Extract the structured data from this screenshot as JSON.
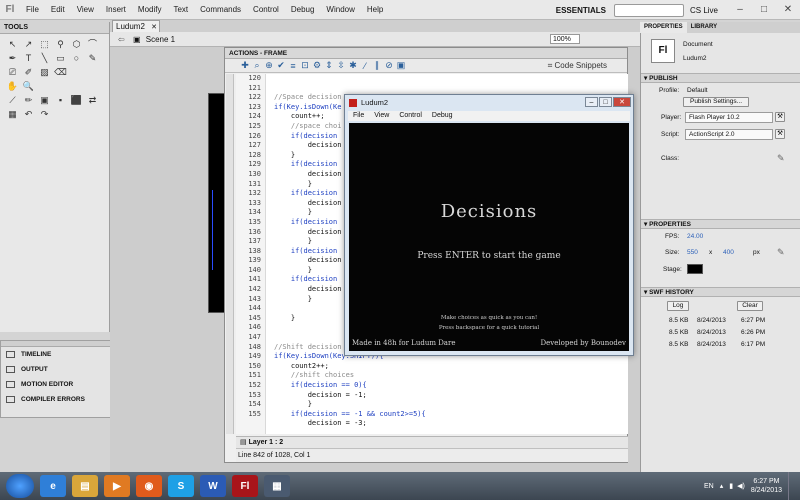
{
  "menubar": {
    "logo": "Fl",
    "items": [
      "File",
      "Edit",
      "View",
      "Insert",
      "Modify",
      "Text",
      "Commands",
      "Control",
      "Debug",
      "Window",
      "Help"
    ],
    "workspace": "ESSENTIALS",
    "cs_live": "CS Live",
    "win_min": "–",
    "win_max": "□",
    "win_close": "✕"
  },
  "document_tab": {
    "label": "Ludum2",
    "close": "✕"
  },
  "scene_label": "Scene 1",
  "zoom": "100%",
  "tools_panel": {
    "title": "TOOLS",
    "tools": [
      "↖",
      "↗",
      "⬚",
      "⚲",
      "⬡",
      "⌒",
      "✒",
      "T",
      "╲",
      "▭",
      "○",
      "✎",
      "⎚",
      "✐",
      "▨",
      "⌫",
      "",
      "",
      "✋",
      "🔍",
      "",
      "",
      "",
      "",
      "⟋",
      "✏",
      "▣",
      "▪",
      "⬛",
      "⇄",
      "▦",
      "↶",
      "↷",
      "",
      "",
      ""
    ]
  },
  "dock_panel": {
    "items": [
      "TIMELINE",
      "OUTPUT",
      "MOTION EDITOR",
      "COMPILER ERRORS"
    ]
  },
  "actions": {
    "title": "ACTIONS - FRAME",
    "code_snippets": "Code Snippets",
    "layer": "Layer 1 : 2",
    "status": "Line 842 of 1028, Col 1",
    "line_numbers": [
      "120",
      "121",
      "122",
      "123",
      "124",
      "125",
      "126",
      "127",
      "128",
      "129",
      "130",
      "131",
      "132",
      "133",
      "134",
      "135",
      "136",
      "137",
      "138",
      "139",
      "140",
      "141",
      "142",
      "143",
      "144",
      "145",
      "146",
      "147",
      "148",
      "149",
      "150",
      "151",
      "152",
      "153",
      "154",
      "155"
    ],
    "code_lines": [
      {
        "t": "",
        "c": "plain"
      },
      {
        "t": "",
        "c": "plain"
      },
      {
        "t": "//Space decision",
        "c": "cmt"
      },
      {
        "t": "if(Key.isDown(Ke",
        "c": "kw"
      },
      {
        "t": "    count++;",
        "c": "plain"
      },
      {
        "t": "    //space choi",
        "c": "cmt"
      },
      {
        "t": "    if(decision",
        "c": "kw"
      },
      {
        "t": "        decision",
        "c": "plain"
      },
      {
        "t": "    }",
        "c": "plain"
      },
      {
        "t": "    if(decision",
        "c": "kw"
      },
      {
        "t": "        decision",
        "c": "plain"
      },
      {
        "t": "        }",
        "c": "plain"
      },
      {
        "t": "    if(decision",
        "c": "kw"
      },
      {
        "t": "        decision",
        "c": "plain"
      },
      {
        "t": "        }",
        "c": "plain"
      },
      {
        "t": "    if(decision",
        "c": "kw"
      },
      {
        "t": "        decision",
        "c": "plain"
      },
      {
        "t": "        }",
        "c": "plain"
      },
      {
        "t": "    if(decision",
        "c": "kw"
      },
      {
        "t": "        decision",
        "c": "plain"
      },
      {
        "t": "        }",
        "c": "plain"
      },
      {
        "t": "    if(decision",
        "c": "kw"
      },
      {
        "t": "        decision",
        "c": "plain"
      },
      {
        "t": "        }",
        "c": "plain"
      },
      {
        "t": "",
        "c": "plain"
      },
      {
        "t": "    }",
        "c": "plain"
      },
      {
        "t": "",
        "c": "plain"
      },
      {
        "t": "",
        "c": "plain"
      },
      {
        "t": "//Shift decision",
        "c": "cmt"
      },
      {
        "t": "if(Key.isDown(Key.SHIFT)){",
        "c": "kw"
      },
      {
        "t": "    count2++;",
        "c": "plain"
      },
      {
        "t": "    //shift choices",
        "c": "cmt"
      },
      {
        "t": "    if(decision == 0){",
        "c": "kw"
      },
      {
        "t": "        decision = -1;",
        "c": "plain"
      },
      {
        "t": "        }",
        "c": "plain"
      },
      {
        "t": "    if(decision == -1 && count2>=5){",
        "c": "kw"
      },
      {
        "t": "        decision = -3;",
        "c": "plain"
      }
    ]
  },
  "player": {
    "title": "Ludum2",
    "menu": [
      "File",
      "View",
      "Control",
      "Debug"
    ],
    "game": {
      "title": "Decisions",
      "press": "Press ENTER to start the game",
      "tip1": "Make choices as quick as you can!",
      "tip2": "Press backspace for a quick tutorial",
      "made_in": "Made in 48h for Ludum Dare",
      "developed": "Developed by Bounodev"
    }
  },
  "properties": {
    "tabs": [
      "PROPERTIES",
      "LIBRARY"
    ],
    "doc_icon": "Fl",
    "doc_type": "Document",
    "doc_name": "Ludum2",
    "publish_header": "PUBLISH",
    "profile_label": "Profile:",
    "profile_value": "Default",
    "publish_settings": "Publish Settings...",
    "player_label": "Player:",
    "player_value": "Flash Player 10.2",
    "script_label": "Script:",
    "script_value": "ActionScript 2.0",
    "class_label": "Class:",
    "properties_header": "PROPERTIES",
    "fps_label": "FPS:",
    "fps_value": "24.00",
    "size_label": "Size:",
    "size_w": "550",
    "size_x": "x",
    "size_h": "400",
    "size_unit": "px",
    "stage_label": "Stage:",
    "stage_color": "#000000",
    "history_header": "SWF HISTORY",
    "log_button": "Log",
    "clear_button": "Clear",
    "history": [
      {
        "size": "8.5 KB",
        "date": "8/24/2013",
        "time": "6:27 PM"
      },
      {
        "size": "8.5 KB",
        "date": "8/24/2013",
        "time": "6:26 PM"
      },
      {
        "size": "8.5 KB",
        "date": "8/24/2013",
        "time": "6:17 PM"
      }
    ]
  },
  "taskbar": {
    "apps": [
      {
        "name": "ie",
        "glyph": "e",
        "color": "#2f7fd8"
      },
      {
        "name": "explorer",
        "glyph": "▤",
        "color": "#d9a63a"
      },
      {
        "name": "media",
        "glyph": "▶",
        "color": "#e07a22"
      },
      {
        "name": "firefox",
        "glyph": "◉",
        "color": "#e05b1c"
      },
      {
        "name": "skype",
        "glyph": "S",
        "color": "#1ea0e6"
      },
      {
        "name": "word",
        "glyph": "W",
        "color": "#2b5bb5"
      },
      {
        "name": "flash",
        "glyph": "Fl",
        "color": "#a8151a"
      },
      {
        "name": "flash-player",
        "glyph": "▦",
        "color": "#4a5a70"
      }
    ],
    "lang": "EN",
    "time": "6:27 PM",
    "date": "8/24/2013"
  }
}
